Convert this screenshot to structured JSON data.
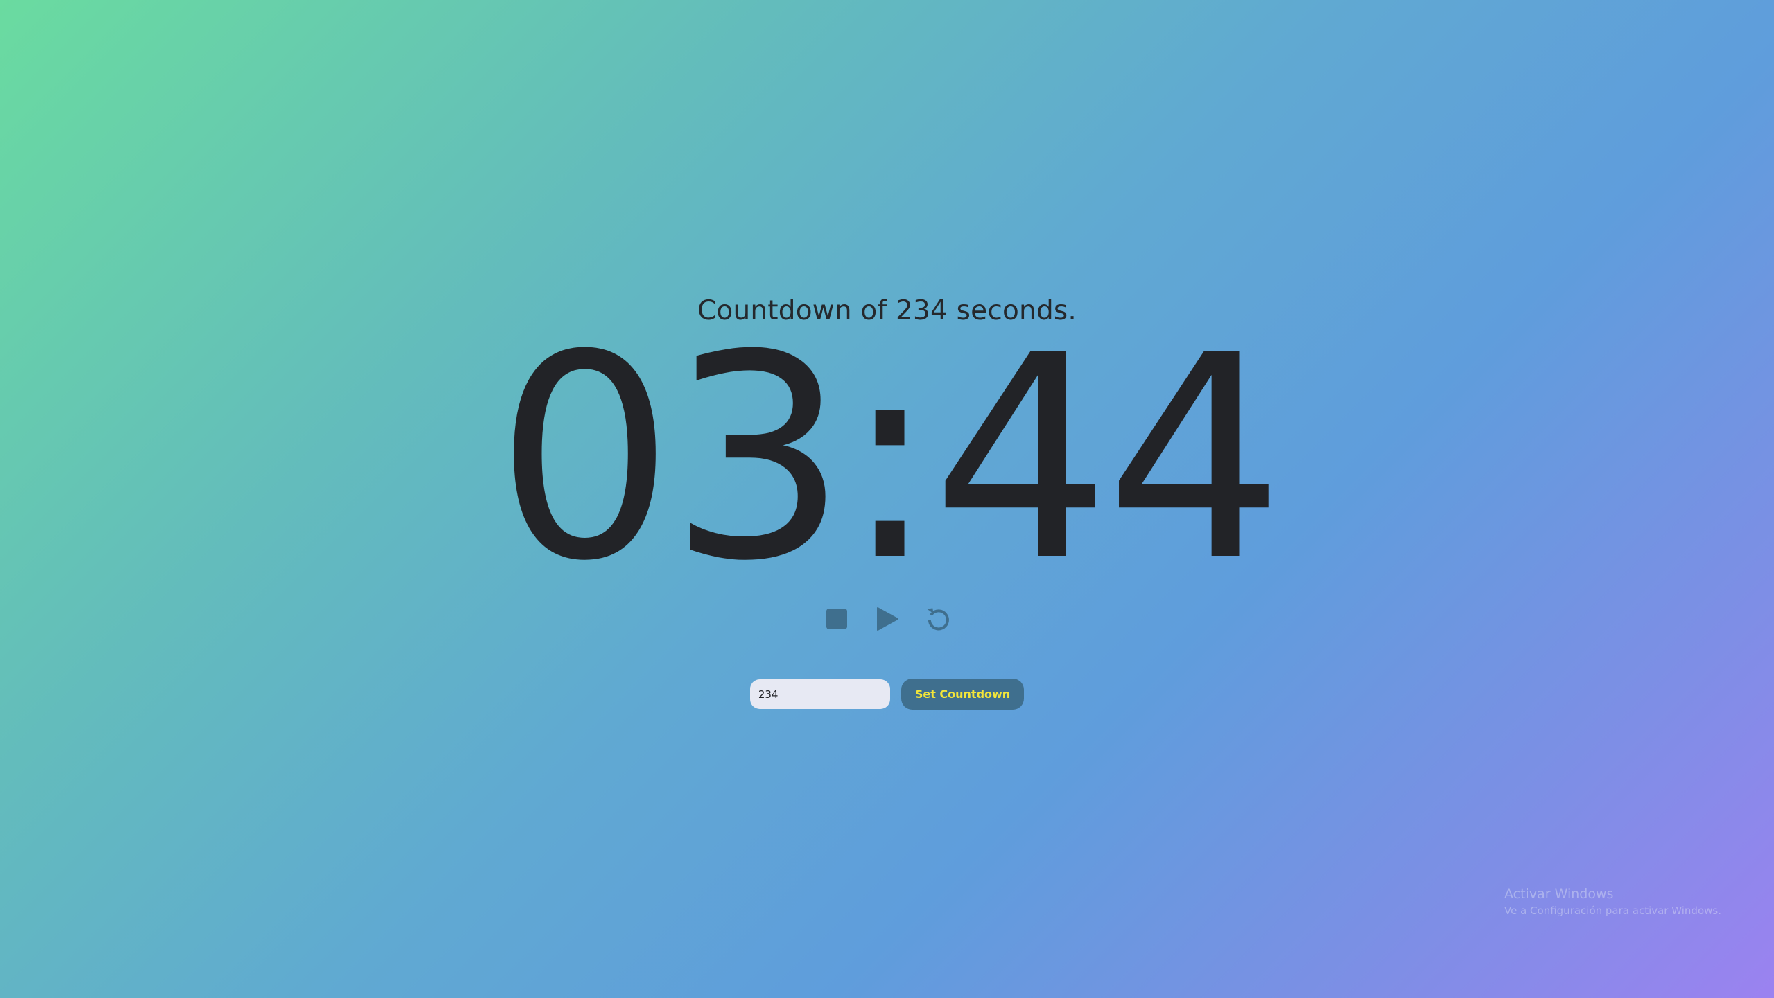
{
  "countdown": {
    "subtitle": "Countdown of 234 seconds.",
    "time_display": "03:44"
  },
  "controls": {
    "stop_icon": "stop-icon",
    "play_icon": "play-icon",
    "reset_icon": "reset-icon",
    "icon_color": "#3f6f8e"
  },
  "form": {
    "seconds_value": "234",
    "set_button_label": "Set Countdown",
    "button_bg": "#3f6f8e",
    "button_text_color": "#f2e53a"
  },
  "watermark": {
    "title": "Activar Windows",
    "subtitle": "Ve a Configuración para activar Windows."
  }
}
